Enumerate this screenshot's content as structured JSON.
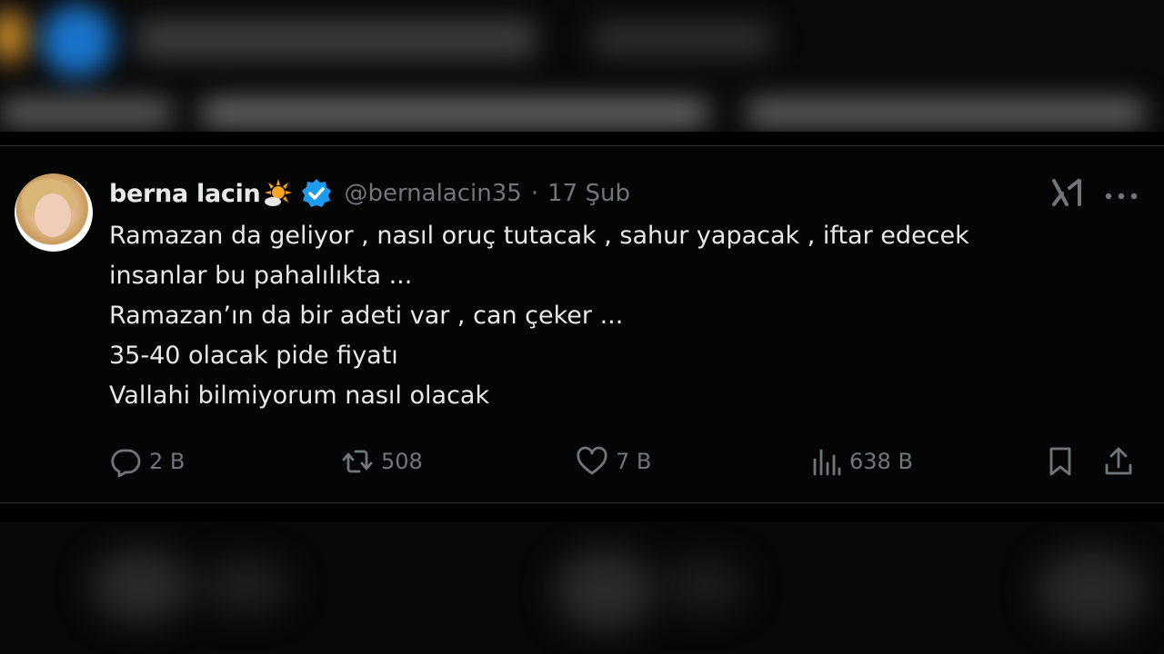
{
  "tweet": {
    "author_name": "berna lacin",
    "handle": "@bernalacin35",
    "separator": "·",
    "date": "17 Şub",
    "lines": [
      "Ramazan da geliyor , nasıl oruç tutacak , sahur yapacak , iftar edecek",
      "insanlar bu pahalılıkta ...",
      "Ramazan’ın da bir adeti var , can çeker ...",
      "35-40 olacak pide fiyatı",
      "Vallahi bilmiyorum nasıl olacak"
    ],
    "stats": {
      "replies": "2 B",
      "reposts": "508",
      "likes": "7 B",
      "views": "638 B"
    }
  },
  "colors": {
    "background": "#000000",
    "text": "#e7e9ea",
    "muted": "#71767b",
    "verified": "#1d9bf0",
    "sun": "#f5a623"
  },
  "icons": {
    "reply": "speech-bubble",
    "repost": "repost-arrows",
    "like": "heart",
    "views": "bar-chart",
    "bookmark": "bookmark",
    "share": "upload-arrow",
    "grok": "grok-logo",
    "more": "three-dots",
    "verified": "checkmark-badge",
    "emoji": "sun-behind-small-cloud"
  }
}
